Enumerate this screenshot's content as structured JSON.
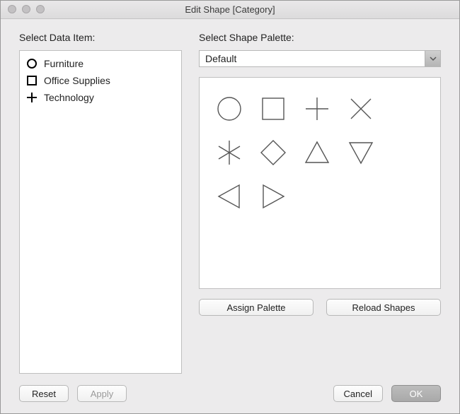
{
  "window": {
    "title": "Edit Shape [Category]"
  },
  "left": {
    "label": "Select Data Item:",
    "items": [
      {
        "icon": "circle",
        "label": "Furniture"
      },
      {
        "icon": "square",
        "label": "Office Supplies"
      },
      {
        "icon": "plus",
        "label": "Technology"
      }
    ]
  },
  "right": {
    "label": "Select Shape Palette:",
    "dropdown": {
      "selected": "Default"
    },
    "shapes": [
      "circle",
      "square",
      "plus",
      "x",
      "asterisk",
      "diamond",
      "triangle-up",
      "triangle-down",
      "triangle-left",
      "triangle-right"
    ],
    "assign_label": "Assign Palette",
    "reload_label": "Reload Shapes"
  },
  "footer": {
    "reset": "Reset",
    "apply": "Apply",
    "cancel": "Cancel",
    "ok": "OK"
  }
}
